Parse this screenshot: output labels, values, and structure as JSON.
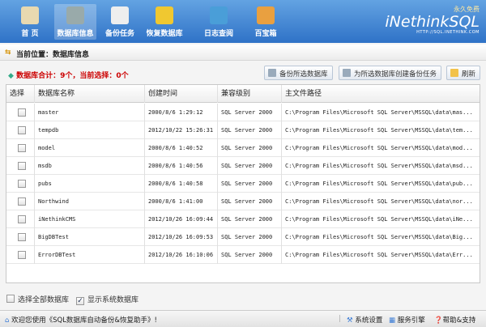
{
  "nav": [
    {
      "label": "首 页",
      "icon": "home-icon",
      "active": false
    },
    {
      "label": "数据库信息",
      "icon": "database-icon",
      "active": true
    },
    {
      "label": "备份任务",
      "icon": "clock-icon",
      "active": false
    },
    {
      "label": "恢复数据库",
      "icon": "refresh-icon",
      "active": false
    },
    {
      "label": "日志查阅",
      "icon": "book-icon",
      "active": false
    },
    {
      "label": "百宝箱",
      "icon": "box-icon",
      "active": false
    }
  ],
  "brand": {
    "free": "永久免费",
    "logo": "iNethinkSQL",
    "url": "HTTP://SQL.INETHINK.COM"
  },
  "breadcrumb": "当前位置：数据库信息",
  "summary": "数据库合计：9个，当前选择：0个",
  "toolbar": {
    "backup": "备份所选数据库",
    "create_task": "为所选数据库创建备份任务",
    "refresh": "刷新"
  },
  "table": {
    "headers": [
      "选择",
      "数据库名称",
      "创建时间",
      "兼容级别",
      "主文件路径"
    ],
    "rows": [
      {
        "name": "master",
        "created": "2000/8/6 1:29:12",
        "compat": "SQL Server 2000",
        "path": "C:\\Program Files\\Microsoft SQL Server\\MSSQL\\data\\mas...",
        "checked": false
      },
      {
        "name": "tempdb",
        "created": "2012/10/22 15:26:31",
        "compat": "SQL Server 2000",
        "path": "C:\\Program Files\\Microsoft SQL Server\\MSSQL\\data\\tem...",
        "checked": false
      },
      {
        "name": "model",
        "created": "2000/8/6 1:40:52",
        "compat": "SQL Server 2000",
        "path": "C:\\Program Files\\Microsoft SQL Server\\MSSQL\\data\\mod...",
        "checked": false
      },
      {
        "name": "msdb",
        "created": "2000/8/6 1:40:56",
        "compat": "SQL Server 2000",
        "path": "C:\\Program Files\\Microsoft SQL Server\\MSSQL\\data\\msd...",
        "checked": false
      },
      {
        "name": "pubs",
        "created": "2000/8/6 1:40:58",
        "compat": "SQL Server 2000",
        "path": "C:\\Program Files\\Microsoft SQL Server\\MSSQL\\data\\pub...",
        "checked": false
      },
      {
        "name": "Northwind",
        "created": "2000/8/6 1:41:00",
        "compat": "SQL Server 2000",
        "path": "C:\\Program Files\\Microsoft SQL Server\\MSSQL\\data\\nor...",
        "checked": false
      },
      {
        "name": "iNethinkCMS",
        "created": "2012/10/26 16:09:44",
        "compat": "SQL Server 2000",
        "path": "C:\\Program Files\\Microsoft SQL Server\\MSSQL\\data\\iNe...",
        "checked": false
      },
      {
        "name": "BigDBTest",
        "created": "2012/10/26 16:09:53",
        "compat": "SQL Server 2000",
        "path": "C:\\Program Files\\Microsoft SQL Server\\MSSQL\\data\\Big...",
        "checked": false
      },
      {
        "name": "ErrorDBTest",
        "created": "2012/10/26 16:10:06",
        "compat": "SQL Server 2000",
        "path": "C:\\Program Files\\Microsoft SQL Server\\MSSQL\\data\\Err...",
        "checked": false
      }
    ]
  },
  "options": {
    "select_all": "选择全部数据库",
    "select_all_checked": false,
    "show_system": "显示系统数据库",
    "show_system_checked": true
  },
  "status": {
    "welcome": "欢迎您使用《SQL数据库自动备份&恢复助手》!",
    "settings": "系统设置",
    "service": "服务引擎",
    "help": "帮助&支持"
  }
}
